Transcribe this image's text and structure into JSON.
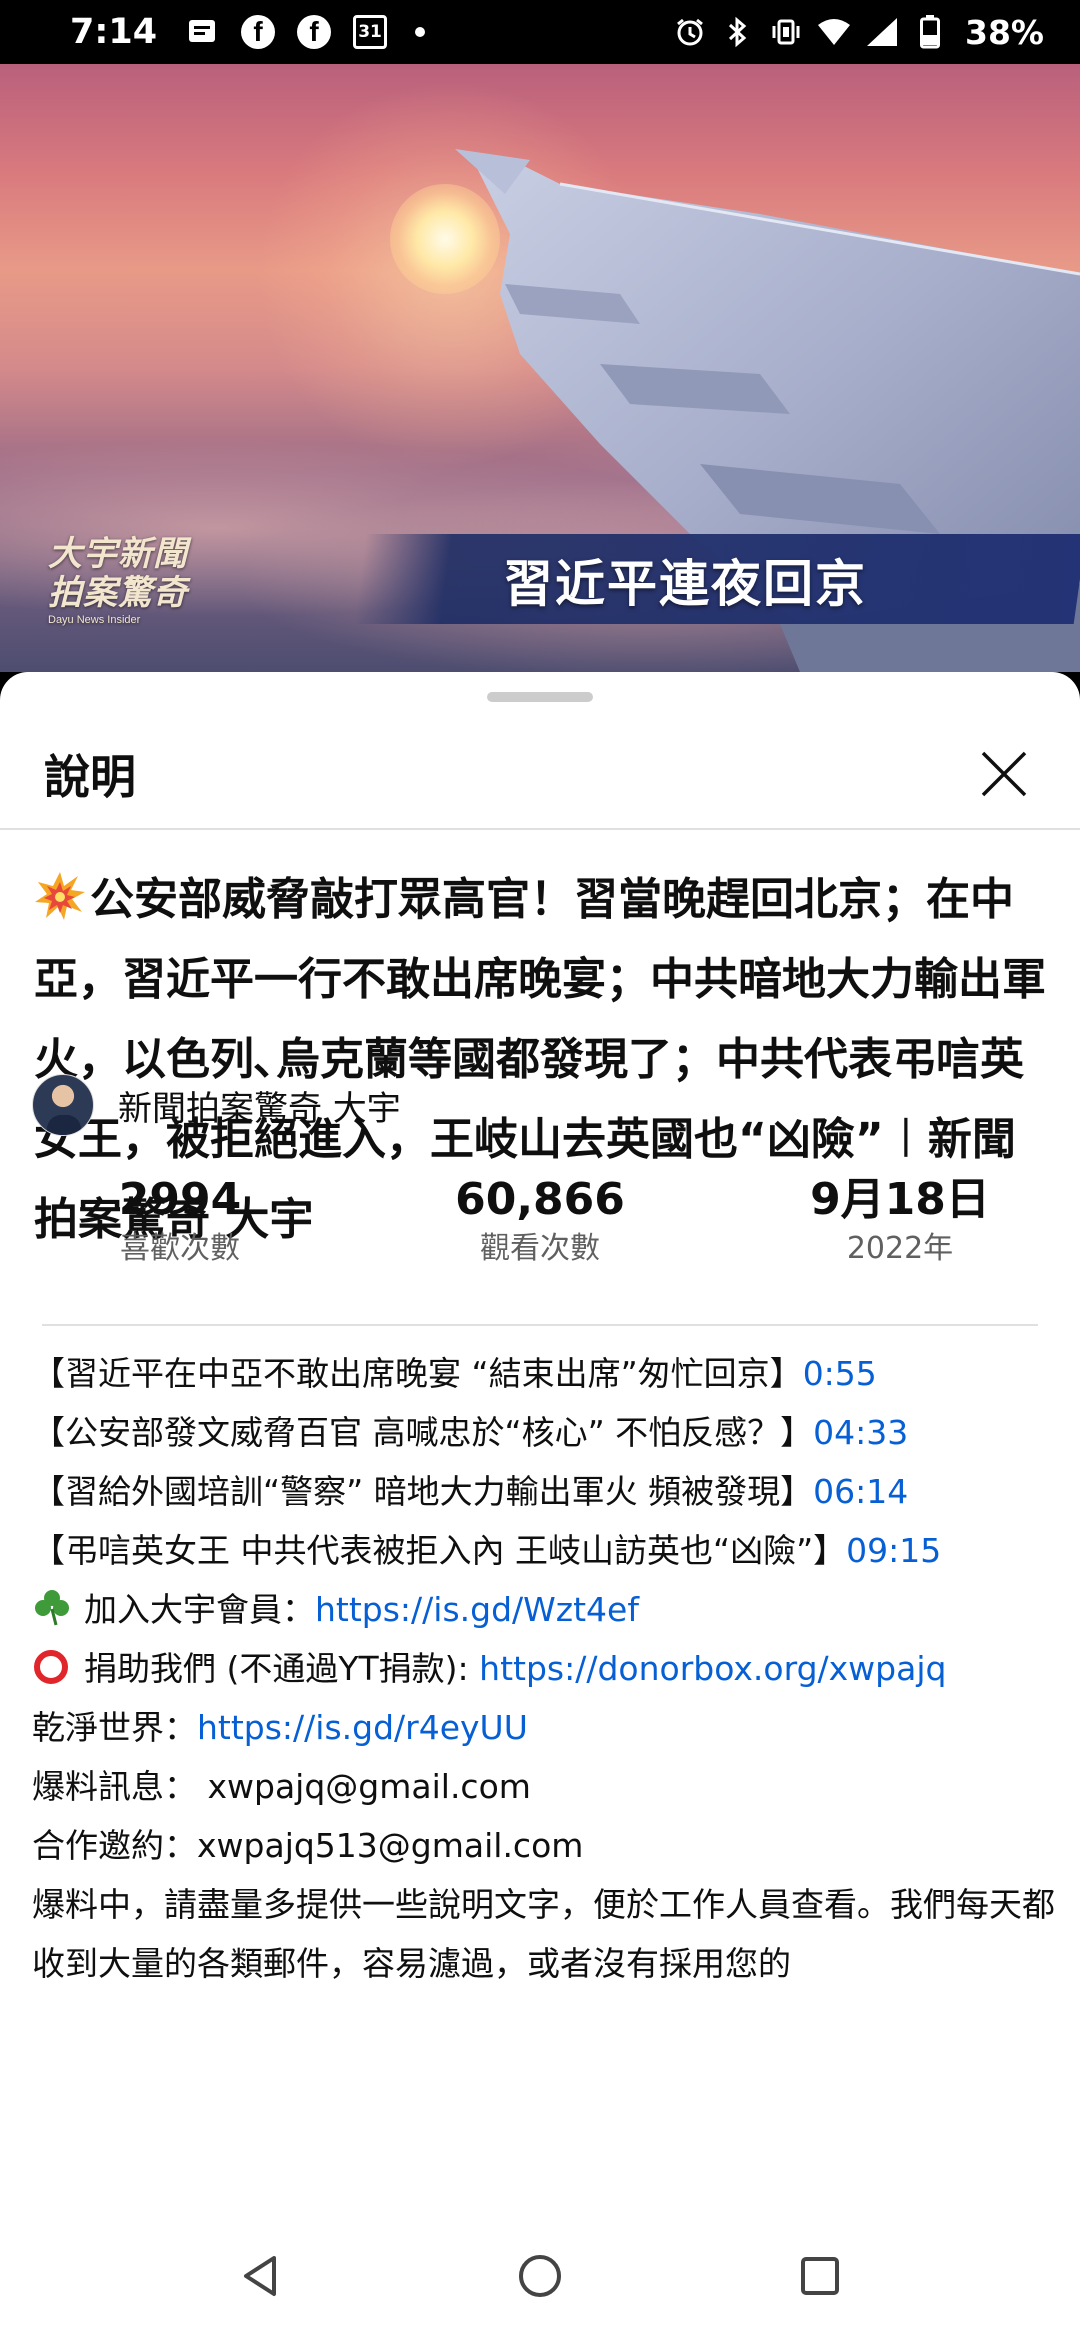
{
  "status_bar": {
    "time": "7:14",
    "fb1": "f",
    "fb2": "f",
    "calendar": "31",
    "battery": "38%"
  },
  "video": {
    "banner_text": "習近平連夜回京",
    "logo_line1": "大宇新聞",
    "logo_line2": "拍案驚奇",
    "logo_small": "Dayu News Insider",
    "progress_fraction": 0.02,
    "buffer_fraction": 0.865
  },
  "sheet": {
    "title": "說明",
    "video_title": "公安部威脅敲打眾高官！習當晚趕回北京；在中亞，習近平一行不敢出席晚宴；中共暗地大力輸出軍火，以色列､烏克蘭等國都發現了；中共代表弔唁英女王，被拒絕進入，王岐山去英國也“凶險”︱新聞拍案驚奇 大宇",
    "channel_name": "新聞拍案驚奇 大宇",
    "stats": [
      {
        "value": "2994",
        "label": "喜歡次數"
      },
      {
        "value": "60,866",
        "label": "觀看次數"
      },
      {
        "value": "9月18日",
        "label": "2022年"
      }
    ]
  },
  "description": {
    "chapters": [
      {
        "text": "【習近平在中亞不敢出席晚宴 “結束出席”匆忙回京】",
        "time": "0:55"
      },
      {
        "text": "【公安部發文威脅百官 高喊忠於“核心” 不怕反感？】",
        "time": "04:33"
      },
      {
        "text": "【習給外國培訓“警察” 暗地大力輸出軍火 頻被發現】",
        "time": "06:14"
      },
      {
        "text": "【弔唁英女王 中共代表被拒入內 王岐山訪英也“凶險”】",
        "time": "09:15"
      }
    ],
    "member_label": "加入大宇會員：",
    "member_link": "https://is.gd/Wzt4ef",
    "donate_label": "捐助我們 (不通過YT捐款): ",
    "donate_link": "https://donorbox.org/xwpajq",
    "clean_label": "乾淨世界：",
    "clean_link": "https://is.gd/r4eyUU",
    "tips_label": "爆料訊息： xwpajq@gmail.com",
    "coop_label": "合作邀約：xwpajq513@gmail.com",
    "tips_paragraph": "爆料中，請盡量多提供一些說明文字，便於工作人員查看。我們每天都收到大量的各類郵件，容易濾過，或者沒有採用您的"
  },
  "colors": {
    "link": "#065fd4",
    "progress": "#ff0000"
  }
}
